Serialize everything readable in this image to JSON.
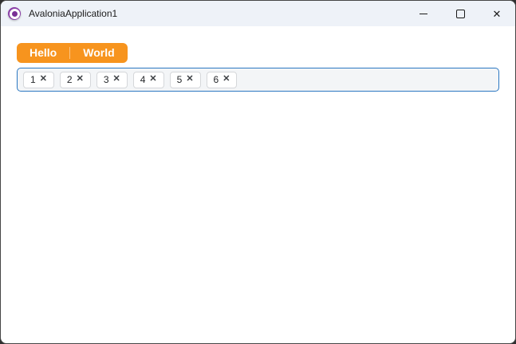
{
  "window": {
    "title": "AvaloniaApplication1",
    "controls": {
      "minimize_icon": "minimize-icon",
      "maximize_icon": "maximize-icon",
      "close_glyph": "✕"
    }
  },
  "tab_strip": {
    "tabs": [
      {
        "label": "Hello"
      },
      {
        "label": "World"
      }
    ]
  },
  "chip_input": {
    "remove_icon": "✕",
    "items": [
      {
        "label": "1"
      },
      {
        "label": "2"
      },
      {
        "label": "3"
      },
      {
        "label": "4"
      },
      {
        "label": "5"
      },
      {
        "label": "6"
      }
    ]
  },
  "colors": {
    "accent_orange": "#F7941E",
    "focus_border_blue": "#2B77C2",
    "titlebar_bg": "#EEF2F8",
    "chipbox_bg": "#F3F5F7",
    "logo_purple": "#8B3FA8",
    "window_border": "#464646"
  }
}
